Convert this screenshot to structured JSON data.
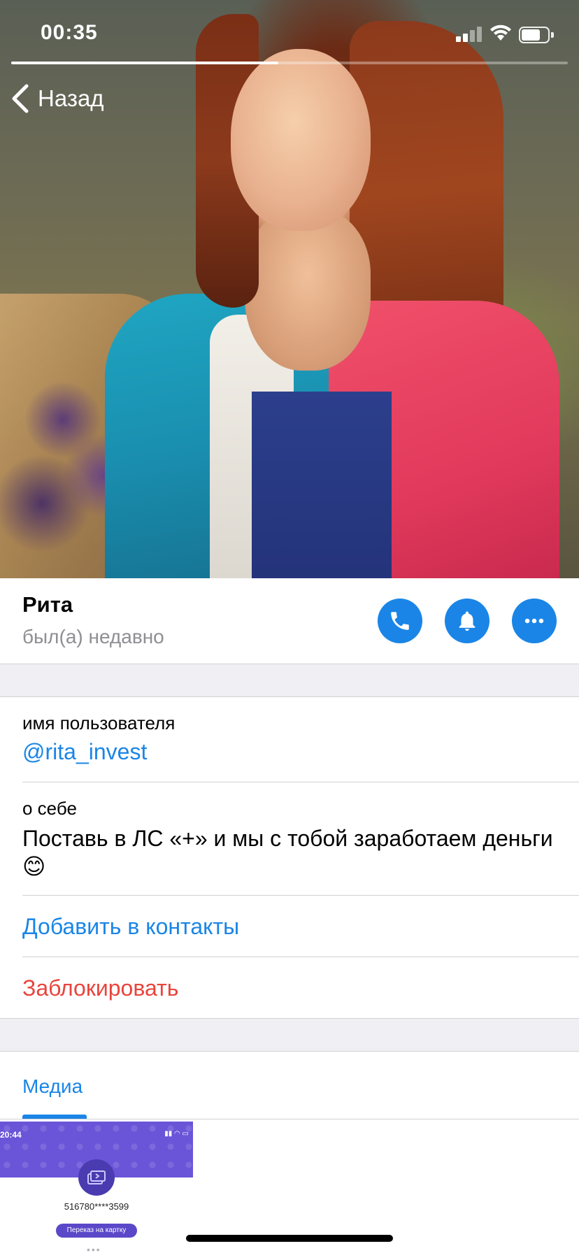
{
  "status_bar": {
    "time": "00:35",
    "signal_bars_active": 2,
    "signal_bars_total": 4,
    "battery_level_fraction": 0.6
  },
  "story_progress": {
    "fraction": 0.48
  },
  "nav": {
    "back_label": "Назад",
    "back_icon": "chevron-left-icon"
  },
  "profile": {
    "name": "Рита",
    "last_seen": "был(а) недавно",
    "actions": {
      "call_icon": "phone-icon",
      "mute_icon": "bell-icon",
      "more_icon": "more-dots-icon"
    },
    "accent_color": "#1a85e6"
  },
  "info": {
    "username_label": "имя пользователя",
    "username_value": "@rita_invest",
    "bio_label": "о себе",
    "bio_value": "Поставь в ЛС «+» и мы с тобой заработаем деньги 😊"
  },
  "actions": {
    "add_contact": "Добавить в контакты",
    "block": "Заблокировать",
    "danger_color": "#e8453c"
  },
  "media": {
    "tab_label": "Медиа",
    "thumbnail": {
      "time": "20:44",
      "card_number": "516780****3599",
      "button_label": "Переказ на картку"
    }
  }
}
